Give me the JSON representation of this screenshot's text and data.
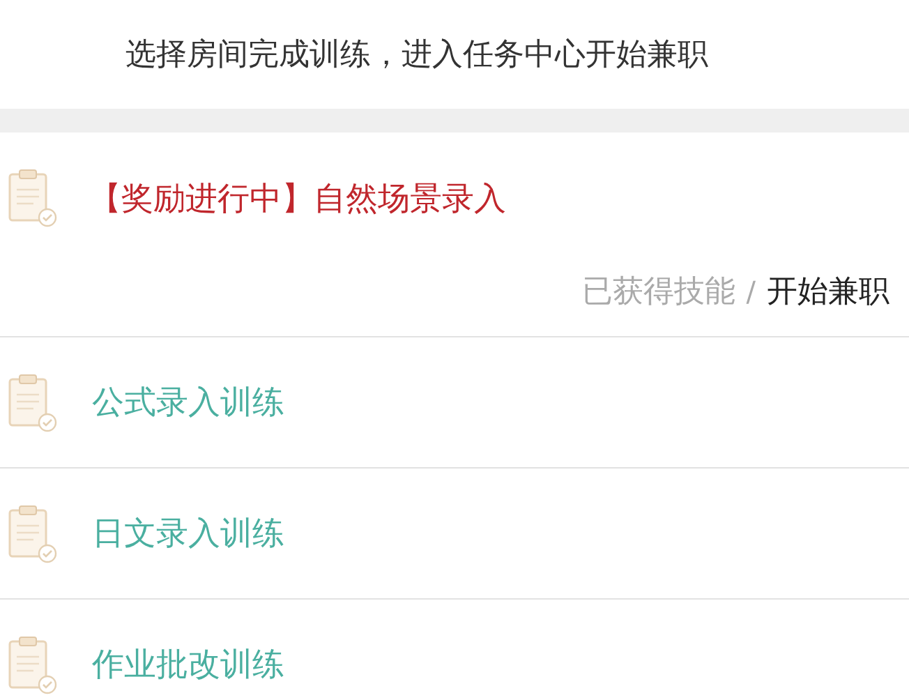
{
  "header": {
    "text": "选择房间完成训练，进入任务中心开始兼职"
  },
  "tasks": [
    {
      "kind": "reward",
      "title": "【奖励进行中】自然场景录入",
      "status": "已获得技能",
      "separator": "/",
      "action": "开始兼职"
    },
    {
      "kind": "training",
      "title": "公式录入训练"
    },
    {
      "kind": "training",
      "title": "日文录入训练"
    },
    {
      "kind": "training",
      "title": "作业批改训练"
    }
  ]
}
